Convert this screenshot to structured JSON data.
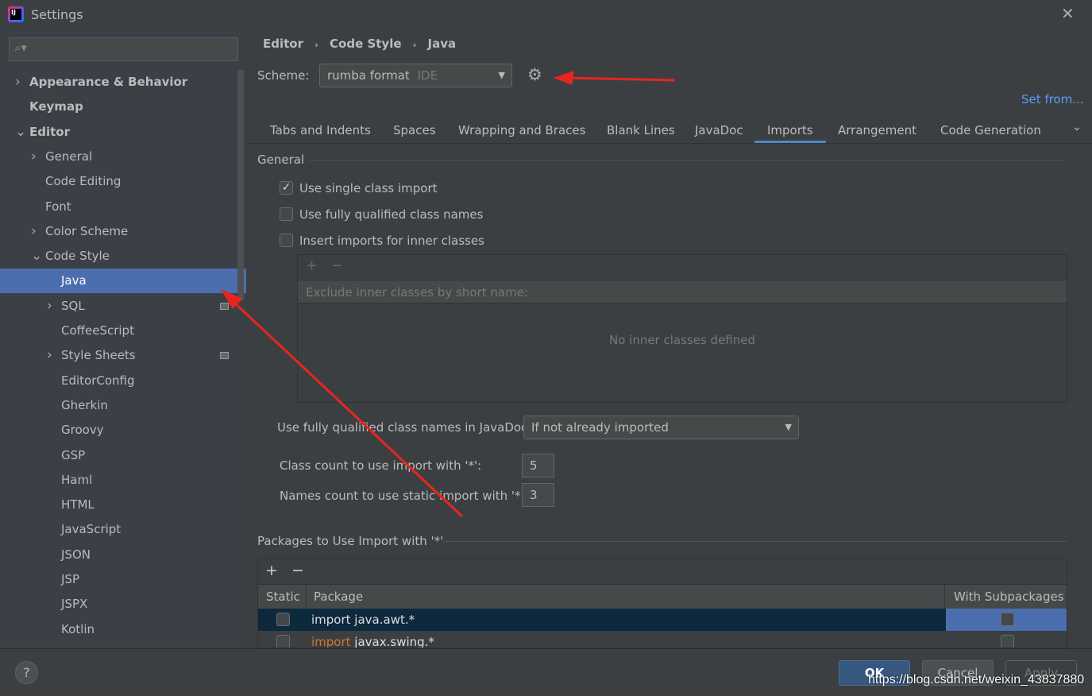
{
  "window": {
    "title": "Settings",
    "close_icon": "close-icon"
  },
  "search": {
    "placeholder": ""
  },
  "sidebar": {
    "items": [
      {
        "label": "Appearance & Behavior",
        "level": 0,
        "arrow": "right",
        "bold": true
      },
      {
        "label": "Keymap",
        "level": 0,
        "bold": true
      },
      {
        "label": "Editor",
        "level": 0,
        "arrow": "down",
        "bold": true
      },
      {
        "label": "General",
        "level": 1,
        "arrow": "right"
      },
      {
        "label": "Code Editing",
        "level": 1
      },
      {
        "label": "Font",
        "level": 1
      },
      {
        "label": "Color Scheme",
        "level": 1,
        "arrow": "right"
      },
      {
        "label": "Code Style",
        "level": 1,
        "arrow": "down"
      },
      {
        "label": "Java",
        "level": 2,
        "selected": true
      },
      {
        "label": "SQL",
        "level": 2,
        "arrow": "right",
        "badge": true
      },
      {
        "label": "CoffeeScript",
        "level": 2
      },
      {
        "label": "Style Sheets",
        "level": 2,
        "arrow": "right",
        "badge": true
      },
      {
        "label": "EditorConfig",
        "level": 2
      },
      {
        "label": "Gherkin",
        "level": 2
      },
      {
        "label": "Groovy",
        "level": 2
      },
      {
        "label": "GSP",
        "level": 2
      },
      {
        "label": "Haml",
        "level": 2
      },
      {
        "label": "HTML",
        "level": 2
      },
      {
        "label": "JavaScript",
        "level": 2
      },
      {
        "label": "JSON",
        "level": 2
      },
      {
        "label": "JSP",
        "level": 2
      },
      {
        "label": "JSPX",
        "level": 2
      },
      {
        "label": "Kotlin",
        "level": 2
      }
    ]
  },
  "breadcrumb": [
    "Editor",
    "Code Style",
    "Java"
  ],
  "scheme": {
    "label": "Scheme:",
    "value": "rumba format",
    "tag": "IDE",
    "set_from": "Set from..."
  },
  "tabs": [
    "Tabs and Indents",
    "Spaces",
    "Wrapping and Braces",
    "Blank Lines",
    "JavaDoc",
    "Imports",
    "Arrangement",
    "Code Generation"
  ],
  "active_tab": "Imports",
  "general": {
    "title": "General",
    "checks": [
      {
        "label": "Use single class import",
        "checked": true
      },
      {
        "label": "Use fully qualified class names",
        "checked": false
      },
      {
        "label": "Insert imports for inner classes",
        "checked": false
      }
    ]
  },
  "inner": {
    "header": "Exclude inner classes by short name:",
    "empty": "No inner classes defined"
  },
  "javadoc": {
    "label": "Use fully qualified class names in JavaDoc:",
    "value": "If not already imported"
  },
  "class_count": {
    "label": "Class count to use import with '*':",
    "value": "5"
  },
  "names_count": {
    "label": "Names count to use static import with '*':",
    "value": "3"
  },
  "packages": {
    "title": "Packages to Use Import with '*'",
    "columns": [
      "Static",
      "Package",
      "With Subpackages"
    ],
    "rows": [
      {
        "keyword": "import",
        "name": " java.awt.*",
        "static": false,
        "sub": false,
        "selected": true
      },
      {
        "keyword": "import",
        "name": " javax.swing.*",
        "static": false,
        "sub": false,
        "selected": false
      }
    ]
  },
  "buttons": {
    "ok": "OK",
    "cancel": "Cancel",
    "apply": "Apply",
    "help": "?"
  },
  "watermark": "https://blog.csdn.net/weixin_43837880",
  "colors": {
    "accent": "#4b6eaf",
    "link": "#589df6",
    "keyword": "#cc7832",
    "annotation": "#e8251f"
  }
}
